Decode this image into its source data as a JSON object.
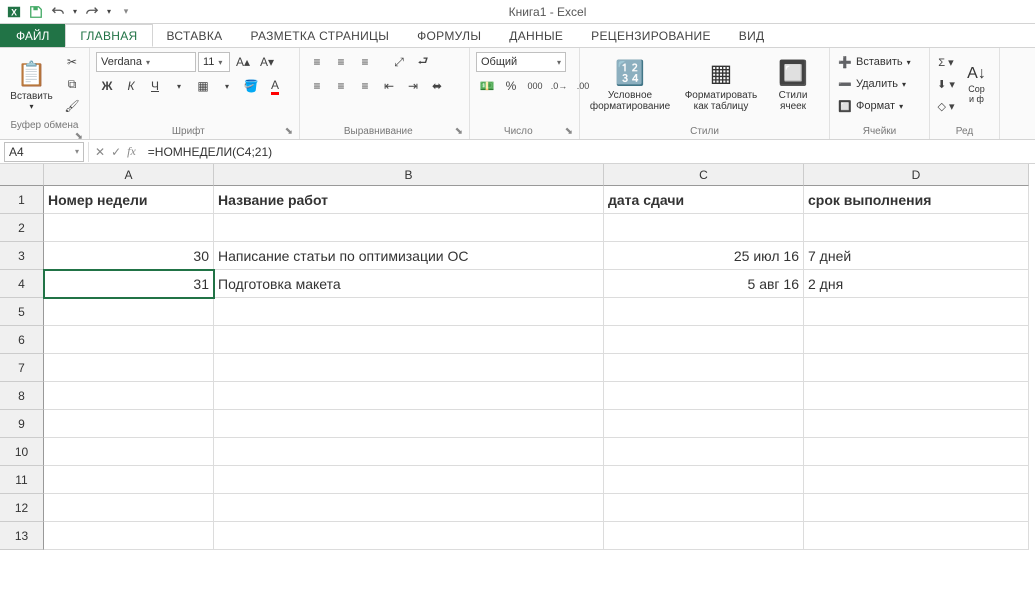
{
  "app": {
    "title": "Книга1 - Excel"
  },
  "qat": {
    "save": "💾"
  },
  "tabs": {
    "file": "ФАЙЛ",
    "home": "ГЛАВНАЯ",
    "insert": "ВСТАВКА",
    "pagelayout": "РАЗМЕТКА СТРАНИЦЫ",
    "formulas": "ФОРМУЛЫ",
    "data": "ДАННЫЕ",
    "review": "РЕЦЕНЗИРОВАНИЕ",
    "view": "ВИД"
  },
  "ribbon": {
    "clipboard": {
      "paste": "Вставить",
      "group": "Буфер обмена"
    },
    "font": {
      "name": "Verdana",
      "size": "11",
      "group": "Шрифт",
      "bold": "Ж",
      "italic": "К",
      "underline": "Ч"
    },
    "alignment": {
      "group": "Выравнивание"
    },
    "number": {
      "format": "Общий",
      "group": "Число"
    },
    "styles": {
      "cond": "Условное форматирование",
      "table": "Форматировать как таблицу",
      "cell": "Стили ячеек",
      "group": "Стили"
    },
    "cells": {
      "insert": "Вставить",
      "delete": "Удалить",
      "format": "Формат",
      "group": "Ячейки"
    },
    "editing": {
      "sort": "Сор",
      "filter": "и ф",
      "group": "Ред"
    }
  },
  "namebox": "A4",
  "formula": "=НОМНЕДЕЛИ(C4;21)",
  "columns": {
    "A": "A",
    "B": "B",
    "C": "C",
    "D": "D"
  },
  "rows": [
    "1",
    "2",
    "3",
    "4",
    "5",
    "6",
    "7",
    "8",
    "9",
    "10",
    "11",
    "12",
    "13"
  ],
  "sheet": {
    "r1": {
      "A": "Номер недели",
      "B": "Название работ",
      "C": "дата сдачи",
      "D": "срок выполнения"
    },
    "r3": {
      "A": "30",
      "B": "Написание статьи по оптимизации ОС",
      "C": "25 июл 16",
      "D": "7 дней"
    },
    "r4": {
      "A": "31",
      "B": "Подготовка макета",
      "C": "5 авг 16",
      "D": "2 дня"
    }
  }
}
